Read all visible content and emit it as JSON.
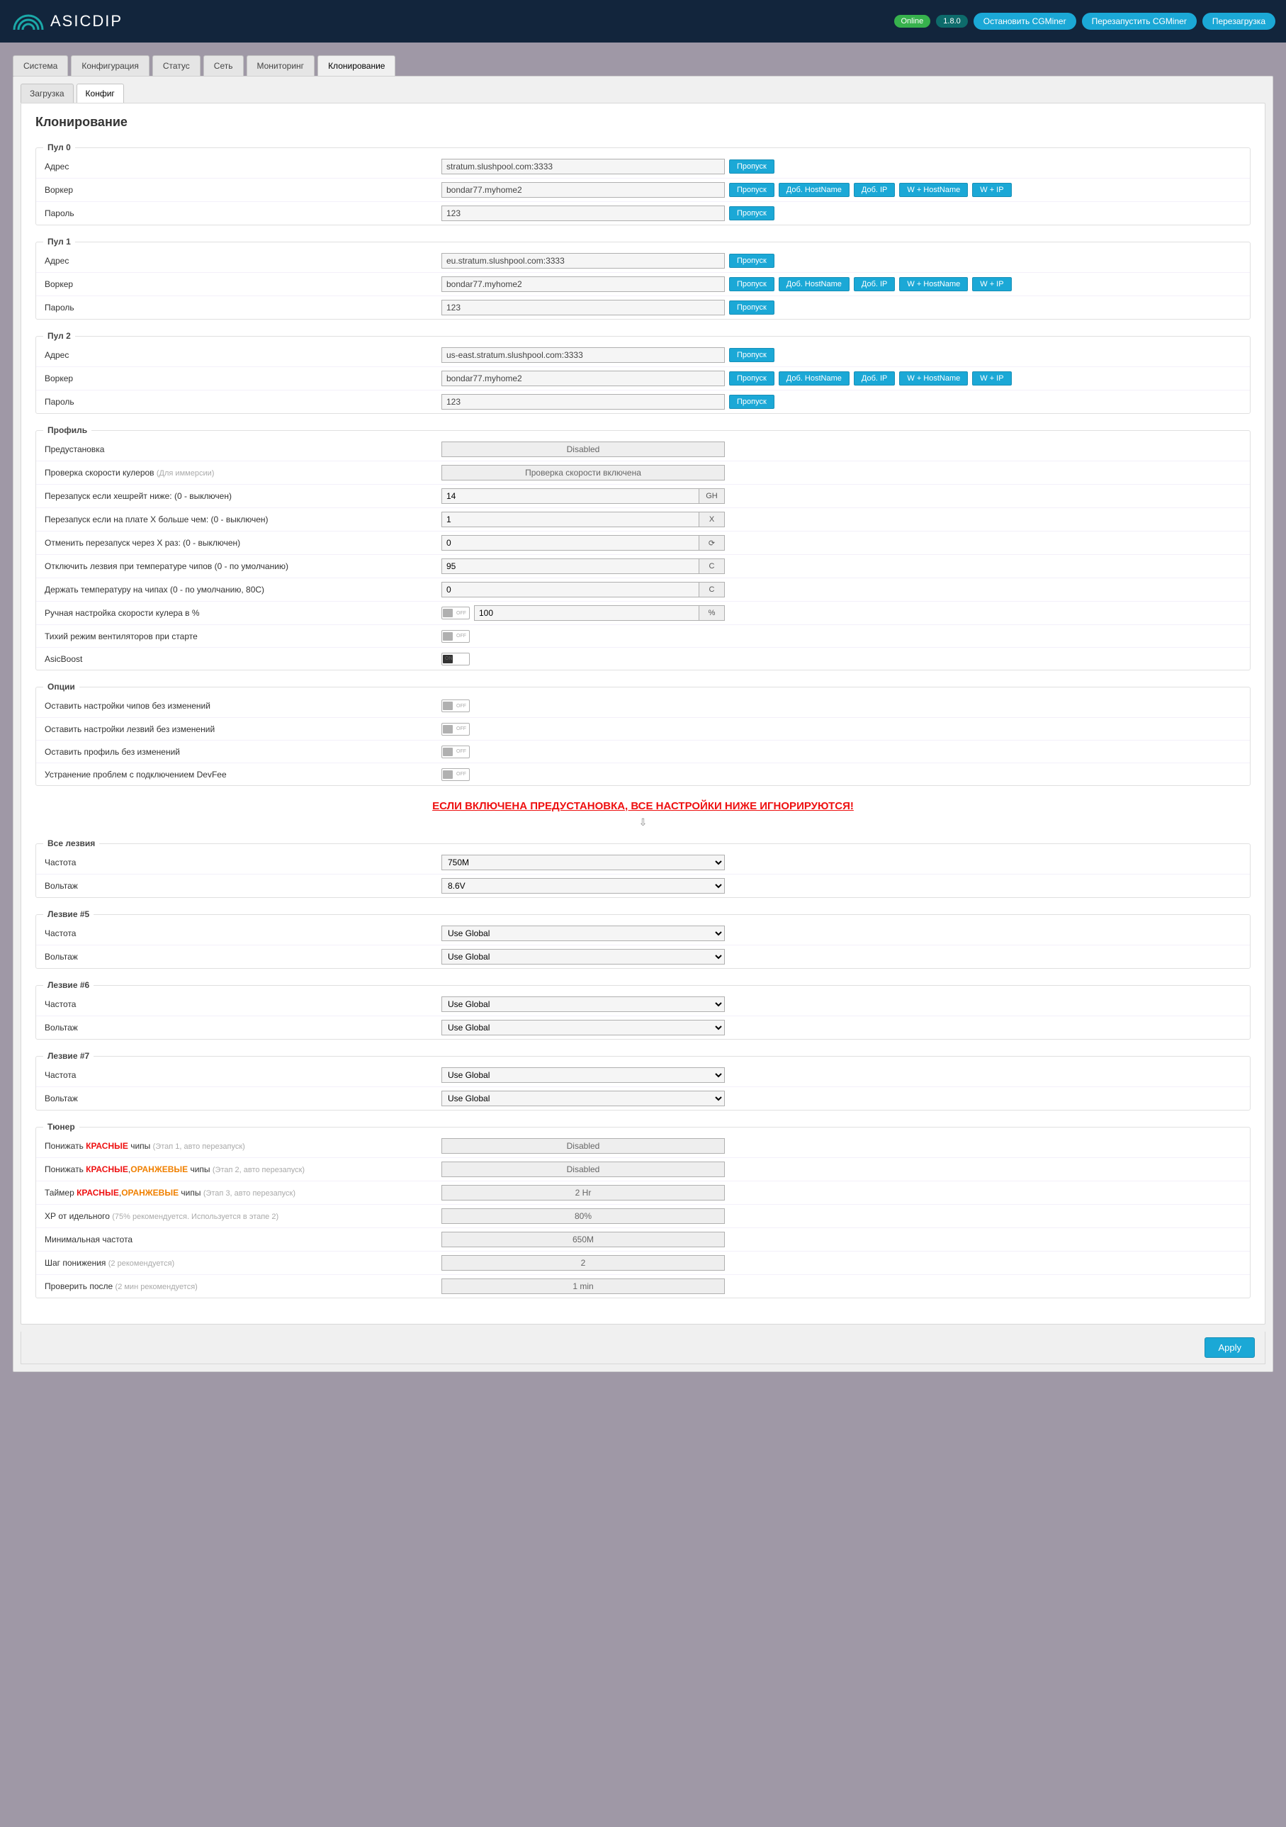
{
  "topbar": {
    "logo_text": "ASICDIP",
    "badge_online": "Online",
    "badge_version": "1.8.0",
    "btn_stop": "Остановить CGMiner",
    "btn_restart": "Перезапустить CGMiner",
    "btn_reboot": "Перезагрузка"
  },
  "tabs_primary": [
    "Система",
    "Конфигурация",
    "Статус",
    "Сеть",
    "Мониторинг",
    "Клонирование"
  ],
  "tabs_primary_active": 5,
  "tabs_secondary": [
    "Загрузка",
    "Конфиг"
  ],
  "tabs_secondary_active": 1,
  "page_title": "Клонирование",
  "labels": {
    "address": "Адрес",
    "worker": "Воркер",
    "password": "Пароль",
    "freq": "Частота",
    "volt": "Вольтаж"
  },
  "buttons": {
    "skip": "Пропуск",
    "add_hostname": "Доб. HostName",
    "add_ip": "Доб. IP",
    "w_hostname": "W + HostName",
    "w_ip": "W + IP"
  },
  "pools": [
    {
      "title": "Пул 0",
      "address": "stratum.slushpool.com:3333",
      "worker": "bondar77.myhome2",
      "password": "123"
    },
    {
      "title": "Пул 1",
      "address": "eu.stratum.slushpool.com:3333",
      "worker": "bondar77.myhome2",
      "password": "123"
    },
    {
      "title": "Пул 2",
      "address": "us-east.stratum.slushpool.com:3333",
      "worker": "bondar77.myhome2",
      "password": "123"
    }
  ],
  "profile": {
    "title": "Профиль",
    "preset_label": "Предустановка",
    "preset_value": "Disabled",
    "fancheck_label": "Проверка скорости кулеров",
    "fancheck_hint": "(Для иммерсии)",
    "fancheck_value": "Проверка скорости включена",
    "restart_hash_label": "Перезапуск если хешрейт ниже: (0 - выключен)",
    "restart_hash_value": "14",
    "restart_hash_unit": "GH",
    "restart_x_label": "Перезапуск если на плате X больше чем: (0 - выключен)",
    "restart_x_value": "1",
    "restart_x_unit": "X",
    "cancel_restart_label": "Отменить перезапуск через X раз: (0 - выключен)",
    "cancel_restart_value": "0",
    "blade_off_label": "Отключить лезвия при температуре чипов (0 - по умолчанию)",
    "blade_off_value": "95",
    "blade_off_unit": "C",
    "chip_temp_label": "Держать температуру на чипах (0 - по умолчанию, 80C)",
    "chip_temp_value": "0",
    "chip_temp_unit": "C",
    "fan_manual_label": "Ручная настройка скорости кулера в %",
    "fan_manual_value": "100",
    "fan_manual_unit": "%",
    "quiet_fan_label": "Тихий режим вентиляторов при старте",
    "asicboost_label": "AsicBoost",
    "toggle_off": "OFF",
    "toggle_on": "ON"
  },
  "options": {
    "title": "Опции",
    "keep_chips": "Оставить настройки чипов без изменений",
    "keep_blades": "Оставить настройки лезвий без изменений",
    "keep_profile": "Оставить профиль без изменений",
    "devfee": "Устранение проблем с подключением DevFee"
  },
  "warning": "ЕСЛИ ВКЛЮЧЕНА ПРЕДУСТАНОВКА, ВСЕ НАСТРОЙКИ НИЖЕ ИГНОРИРУЮТСЯ!",
  "all_blades": {
    "title": "Все лезвия",
    "freq": "750M",
    "volt": "8.6V"
  },
  "blades": [
    {
      "title": "Лезвие #5",
      "freq": "Use Global",
      "volt": "Use Global"
    },
    {
      "title": "Лезвие #6",
      "freq": "Use Global",
      "volt": "Use Global"
    },
    {
      "title": "Лезвие #7",
      "freq": "Use Global",
      "volt": "Use Global"
    }
  ],
  "tuner": {
    "title": "Тюнер",
    "step1_label_pre": "Понижать ",
    "step1_red": "КРАСНЫЕ",
    "step1_label_post": " чипы ",
    "step1_hint": "(Этап 1, авто перезапуск)",
    "step1_value": "Disabled",
    "step2_label_pre": "Понижать ",
    "step2_red": "КРАСНЫЕ",
    "step2_sep": ",",
    "step2_orange": "ОРАНЖЕВЫЕ",
    "step2_label_post": " чипы ",
    "step2_hint": "(Этап 2, авто перезапуск)",
    "step2_value": "Disabled",
    "timer_label_pre": "Таймер ",
    "timer_red": "КРАСНЫЕ",
    "timer_sep": ",",
    "timer_orange": "ОРАНЖЕВЫЕ",
    "timer_label_post": " чипы ",
    "timer_hint": "(Этап 3, авто перезапуск)",
    "timer_value": "2 Hr",
    "hr_label": "ХР от идельного ",
    "hr_hint": "(75% рекомендуется. Используется в этапе 2)",
    "hr_value": "80%",
    "minfreq_label": "Минимальная частота",
    "minfreq_value": "650M",
    "step_label": "Шаг понижения ",
    "step_hint": "(2 рекомендуется)",
    "step_value": "2",
    "check_label": "Проверить после ",
    "check_hint": "(2 мин рекомендуется)",
    "check_value": "1 min"
  },
  "apply": "Apply"
}
